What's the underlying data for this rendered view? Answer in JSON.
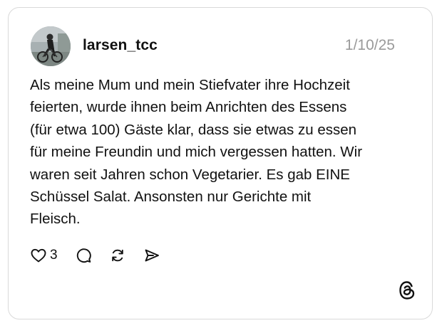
{
  "post": {
    "username": "larsen_tcc",
    "date": "1/10/25",
    "body_lines": [
      "Als meine Mum und mein Stiefvater ihre Hochzeit",
      "feierten, wurde ihnen beim Anrichten des Essens",
      "(für etwa 100) Gäste klar, dass sie etwas zu essen",
      "für meine Freundin und mich vergessen hatten. Wir",
      "waren seit Jahren schon Vegetarier. Es gab EINE",
      "Schüssel Salat. Ansonsten nur Gerichte mit",
      "Fleisch."
    ]
  },
  "actions": {
    "like_icon": "heart-icon",
    "like_count": "3",
    "reply_icon": "comment-bubble-icon",
    "repost_icon": "repost-icon",
    "share_icon": "send-icon"
  },
  "branding": {
    "logo_icon": "threads-logo-icon"
  },
  "colors": {
    "text": "#111111",
    "muted": "#9a9a9a",
    "border": "#d9d9d9",
    "background": "#ffffff"
  }
}
